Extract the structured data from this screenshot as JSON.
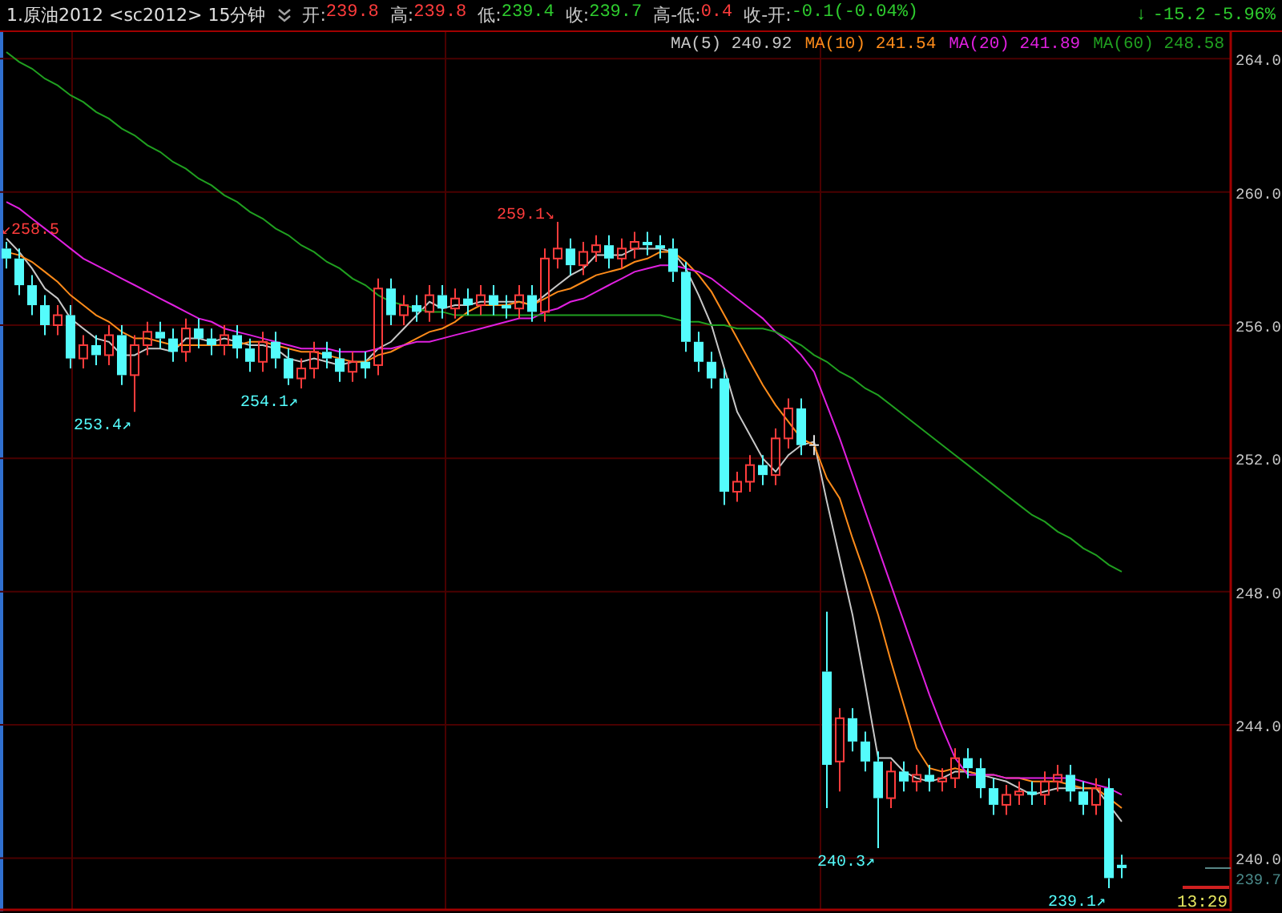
{
  "header": {
    "title": "1.原油2012 <sc2012> 15分钟",
    "quotes": [
      {
        "label": "开:",
        "value": "239.8",
        "color": "#ff3c3c"
      },
      {
        "label": "高:",
        "value": "239.8",
        "color": "#ff3c3c"
      },
      {
        "label": "低:",
        "value": "239.4",
        "color": "#2ecc2e"
      },
      {
        "label": "收:",
        "value": "239.7",
        "color": "#2ecc2e"
      },
      {
        "label": "高-低:",
        "value": "0.4",
        "color": "#ff3c3c"
      },
      {
        "label": "收-开:",
        "value": "-0.1(-0.04%)",
        "color": "#2ecc2e"
      }
    ],
    "change": {
      "arrow": "↓",
      "value": "-15.2",
      "percent": "-5.96%",
      "color": "#2ecc2e"
    }
  },
  "chart": {
    "last_price": "239.7",
    "time": "13:29",
    "legend_values": [
      "240.92",
      "241.54",
      "241.89",
      "248.58"
    ],
    "chart_data": {
      "type": "candlestick",
      "grid": true,
      "ylim": [
        238.4,
        264.8
      ],
      "yticks": [
        {
          "value": 240,
          "label": "240.0"
        },
        {
          "value": 244,
          "label": "244.0"
        },
        {
          "value": 248,
          "label": "248.0"
        },
        {
          "value": 252,
          "label": "252.0"
        },
        {
          "value": 256,
          "label": "256.0"
        },
        {
          "value": 260,
          "label": "260.0"
        },
        {
          "value": 264,
          "label": "264.0"
        }
      ],
      "ohlc": [
        [
          258.3,
          258.5,
          257.7,
          258.0
        ],
        [
          258.0,
          258.3,
          256.9,
          257.2
        ],
        [
          257.2,
          257.5,
          256.3,
          256.6
        ],
        [
          256.6,
          256.9,
          255.7,
          256.0
        ],
        [
          256.0,
          256.6,
          255.7,
          256.3
        ],
        [
          256.3,
          256.6,
          254.7,
          255.0
        ],
        [
          255.0,
          255.7,
          254.7,
          255.4
        ],
        [
          255.4,
          255.7,
          254.8,
          255.1
        ],
        [
          255.1,
          256.0,
          254.8,
          255.7
        ],
        [
          255.7,
          256.0,
          254.2,
          254.5
        ],
        [
          254.5,
          255.7,
          253.4,
          255.4
        ],
        [
          255.4,
          256.1,
          255.1,
          255.8
        ],
        [
          255.8,
          256.1,
          255.3,
          255.6
        ],
        [
          255.6,
          255.9,
          254.9,
          255.2
        ],
        [
          255.2,
          256.2,
          254.9,
          255.9
        ],
        [
          255.9,
          256.2,
          255.3,
          255.6
        ],
        [
          255.6,
          255.9,
          255.1,
          255.4
        ],
        [
          255.4,
          256.0,
          255.1,
          255.7
        ],
        [
          255.7,
          256.0,
          255.0,
          255.3
        ],
        [
          255.3,
          255.6,
          254.6,
          254.9
        ],
        [
          254.9,
          255.8,
          254.6,
          255.5
        ],
        [
          255.5,
          255.8,
          254.7,
          255.0
        ],
        [
          255.0,
          255.3,
          254.2,
          254.4
        ],
        [
          254.4,
          255.0,
          254.1,
          254.7
        ],
        [
          254.7,
          255.5,
          254.4,
          255.2
        ],
        [
          255.2,
          255.5,
          254.7,
          255.0
        ],
        [
          255.0,
          255.3,
          254.3,
          254.6
        ],
        [
          254.6,
          255.2,
          254.3,
          254.9
        ],
        [
          254.9,
          255.2,
          254.4,
          254.7
        ],
        [
          254.8,
          257.4,
          254.5,
          257.1
        ],
        [
          257.1,
          257.4,
          256.0,
          256.3
        ],
        [
          256.3,
          256.9,
          256.0,
          256.6
        ],
        [
          256.6,
          256.9,
          256.1,
          256.4
        ],
        [
          256.4,
          257.2,
          256.1,
          256.9
        ],
        [
          256.9,
          257.2,
          256.2,
          256.5
        ],
        [
          256.5,
          257.1,
          256.2,
          256.8
        ],
        [
          256.8,
          257.1,
          256.3,
          256.6
        ],
        [
          256.6,
          257.2,
          256.3,
          256.9
        ],
        [
          256.9,
          257.2,
          256.3,
          256.6
        ],
        [
          256.6,
          256.9,
          256.2,
          256.5
        ],
        [
          256.5,
          257.2,
          256.2,
          256.9
        ],
        [
          256.9,
          257.2,
          256.1,
          256.4
        ],
        [
          256.4,
          258.3,
          256.1,
          258.0
        ],
        [
          258.0,
          259.1,
          257.7,
          258.3
        ],
        [
          258.3,
          258.6,
          257.5,
          257.8
        ],
        [
          257.8,
          258.5,
          257.5,
          258.2
        ],
        [
          258.2,
          258.7,
          257.9,
          258.4
        ],
        [
          258.4,
          258.7,
          257.7,
          258.0
        ],
        [
          258.0,
          258.6,
          257.7,
          258.3
        ],
        [
          258.3,
          258.8,
          258.0,
          258.5
        ],
        [
          258.5,
          258.8,
          258.1,
          258.4
        ],
        [
          258.4,
          258.7,
          258.0,
          258.3
        ],
        [
          258.3,
          258.6,
          257.3,
          257.6
        ],
        [
          257.6,
          257.9,
          255.2,
          255.5
        ],
        [
          255.5,
          255.8,
          254.6,
          254.9
        ],
        [
          254.9,
          255.2,
          254.1,
          254.4
        ],
        [
          254.4,
          254.7,
          250.6,
          251.0
        ],
        [
          251.0,
          251.6,
          250.7,
          251.3
        ],
        [
          251.3,
          252.1,
          251.0,
          251.8
        ],
        [
          251.8,
          252.1,
          251.2,
          251.5
        ],
        [
          251.5,
          252.9,
          251.2,
          252.6
        ],
        [
          252.6,
          253.8,
          252.3,
          253.5
        ],
        [
          253.5,
          253.8,
          252.1,
          252.4
        ],
        [
          252.4,
          252.7,
          252.1,
          252.4
        ],
        [
          245.6,
          247.4,
          241.5,
          242.8
        ],
        [
          242.9,
          244.5,
          242.0,
          244.2
        ],
        [
          244.2,
          244.5,
          243.2,
          243.5
        ],
        [
          243.5,
          243.8,
          242.6,
          242.9
        ],
        [
          242.9,
          243.2,
          240.3,
          241.8
        ],
        [
          241.8,
          242.9,
          241.5,
          242.6
        ],
        [
          242.6,
          242.9,
          242.0,
          242.3
        ],
        [
          242.3,
          242.8,
          242.0,
          242.5
        ],
        [
          242.5,
          242.8,
          242.0,
          242.3
        ],
        [
          242.3,
          242.7,
          242.0,
          242.4
        ],
        [
          242.4,
          243.3,
          242.1,
          243.0
        ],
        [
          243.0,
          243.3,
          242.4,
          242.7
        ],
        [
          242.7,
          243.0,
          241.8,
          242.1
        ],
        [
          242.1,
          242.4,
          241.3,
          241.6
        ],
        [
          241.6,
          242.2,
          241.3,
          241.9
        ],
        [
          241.9,
          242.3,
          241.6,
          242.0
        ],
        [
          242.0,
          242.3,
          241.6,
          241.9
        ],
        [
          241.9,
          242.6,
          241.6,
          242.3
        ],
        [
          242.3,
          242.8,
          242.0,
          242.5
        ],
        [
          242.5,
          242.8,
          241.7,
          242.0
        ],
        [
          242.0,
          242.3,
          241.3,
          241.6
        ],
        [
          241.6,
          242.4,
          241.3,
          242.1
        ],
        [
          242.1,
          242.4,
          239.1,
          239.4
        ],
        [
          239.8,
          240.1,
          239.4,
          239.7
        ],
        null,
        null,
        null,
        null,
        null,
        null,
        null,
        null
      ],
      "series": [
        {
          "name": "MA(5)",
          "type": "line",
          "color": "#c8c8c8",
          "values": [
            258.6,
            258.2,
            257.7,
            257.1,
            256.8,
            256.2,
            255.9,
            255.6,
            255.5,
            255.1,
            255.1,
            255.3,
            255.3,
            255.2,
            255.6,
            255.6,
            255.5,
            255.6,
            255.5,
            255.4,
            255.4,
            255.3,
            255.0,
            254.9,
            255.0,
            254.9,
            254.8,
            254.9,
            254.9,
            255.3,
            255.5,
            255.9,
            256.3,
            256.7,
            256.5,
            256.6,
            256.6,
            256.7,
            256.7,
            256.7,
            256.7,
            256.6,
            256.9,
            257.2,
            257.5,
            257.7,
            258.1,
            258.1,
            258.1,
            258.3,
            258.3,
            258.3,
            258.2,
            257.7,
            256.9,
            256.0,
            254.7,
            253.4,
            252.7,
            252.0,
            251.6,
            252.1,
            252.4,
            252.5,
            250.7,
            249.0,
            247.3,
            245.2,
            243.0,
            243.0,
            242.6,
            242.4,
            242.3,
            242.4,
            242.6,
            242.6,
            242.5,
            242.4,
            242.3,
            242.1,
            241.9,
            242.0,
            242.1,
            242.1,
            242.1,
            242.1,
            241.6,
            241.1,
            null,
            null,
            null,
            null,
            null,
            null,
            null,
            null
          ]
        },
        {
          "name": "MA(10)",
          "type": "line",
          "color": "#ff8c1a",
          "values": [
            258.2,
            258.1,
            257.9,
            257.6,
            257.3,
            256.9,
            256.6,
            256.3,
            256.1,
            255.8,
            255.6,
            255.6,
            255.5,
            255.4,
            255.4,
            255.4,
            255.4,
            255.4,
            255.4,
            255.5,
            255.5,
            255.4,
            255.3,
            255.2,
            255.2,
            255.1,
            255.0,
            254.9,
            254.9,
            255.1,
            255.2,
            255.4,
            255.6,
            255.8,
            255.9,
            256.1,
            256.4,
            256.6,
            256.6,
            256.6,
            256.7,
            256.6,
            256.8,
            257.0,
            257.1,
            257.3,
            257.5,
            257.6,
            257.7,
            257.9,
            258.0,
            258.2,
            258.2,
            257.9,
            257.5,
            257.0,
            256.3,
            255.6,
            254.9,
            254.2,
            253.6,
            253.1,
            252.6,
            252.4,
            251.4,
            250.8,
            249.6,
            248.5,
            247.3,
            245.9,
            244.6,
            243.3,
            242.7,
            242.6,
            242.7,
            242.6,
            242.5,
            242.5,
            242.4,
            242.4,
            242.3,
            242.3,
            242.3,
            242.2,
            242.1,
            242.1,
            241.8,
            241.5,
            null,
            null,
            null,
            null,
            null,
            null,
            null,
            null
          ]
        },
        {
          "name": "MA(20)",
          "type": "line",
          "color": "#e020e0",
          "values": [
            259.7,
            259.5,
            259.2,
            258.9,
            258.6,
            258.3,
            258.0,
            257.8,
            257.6,
            257.4,
            257.2,
            257.0,
            256.8,
            256.6,
            256.4,
            256.2,
            256.1,
            255.9,
            255.8,
            255.7,
            255.6,
            255.5,
            255.4,
            255.3,
            255.3,
            255.3,
            255.2,
            255.2,
            255.2,
            255.3,
            255.3,
            255.4,
            255.5,
            255.5,
            255.6,
            255.7,
            255.8,
            255.9,
            256.0,
            256.1,
            256.2,
            256.2,
            256.4,
            256.5,
            256.7,
            256.8,
            257.0,
            257.2,
            257.4,
            257.6,
            257.7,
            257.8,
            257.8,
            257.7,
            257.6,
            257.4,
            257.1,
            256.8,
            256.5,
            256.2,
            255.8,
            255.5,
            255.1,
            254.6,
            253.6,
            252.6,
            251.5,
            250.4,
            249.3,
            248.2,
            247.1,
            246.0,
            244.9,
            243.9,
            243.0,
            242.5,
            242.5,
            242.5,
            242.4,
            242.4,
            242.4,
            242.4,
            242.4,
            242.4,
            242.3,
            242.2,
            242.1,
            241.9,
            null,
            null,
            null,
            null,
            null,
            null,
            null,
            null
          ]
        },
        {
          "name": "MA(60)",
          "type": "line",
          "color": "#20a020",
          "values": [
            264.2,
            263.9,
            263.7,
            263.4,
            263.2,
            262.9,
            262.7,
            262.4,
            262.2,
            261.9,
            261.7,
            261.4,
            261.2,
            260.9,
            260.7,
            260.4,
            260.2,
            259.9,
            259.7,
            259.4,
            259.2,
            258.9,
            258.7,
            258.4,
            258.2,
            257.9,
            257.7,
            257.4,
            257.2,
            256.9,
            256.7,
            256.6,
            256.5,
            256.4,
            256.4,
            256.3,
            256.3,
            256.3,
            256.3,
            256.3,
            256.3,
            256.3,
            256.3,
            256.3,
            256.3,
            256.3,
            256.3,
            256.3,
            256.3,
            256.3,
            256.3,
            256.3,
            256.2,
            256.1,
            256.1,
            256.0,
            256.0,
            255.9,
            255.9,
            255.9,
            255.8,
            255.6,
            255.4,
            255.1,
            254.9,
            254.6,
            254.4,
            254.1,
            253.9,
            253.6,
            253.3,
            253.0,
            252.7,
            252.4,
            252.1,
            251.8,
            251.5,
            251.2,
            250.9,
            250.6,
            250.3,
            250.1,
            249.8,
            249.6,
            249.3,
            249.1,
            248.8,
            248.6,
            null,
            null,
            null,
            null,
            null,
            null,
            null,
            null
          ]
        }
      ],
      "annotations": [
        "↙258.5",
        "259.1↘",
        "253.4↗",
        "254.1↗",
        "240.3↗",
        "239.1↗"
      ]
    }
  }
}
